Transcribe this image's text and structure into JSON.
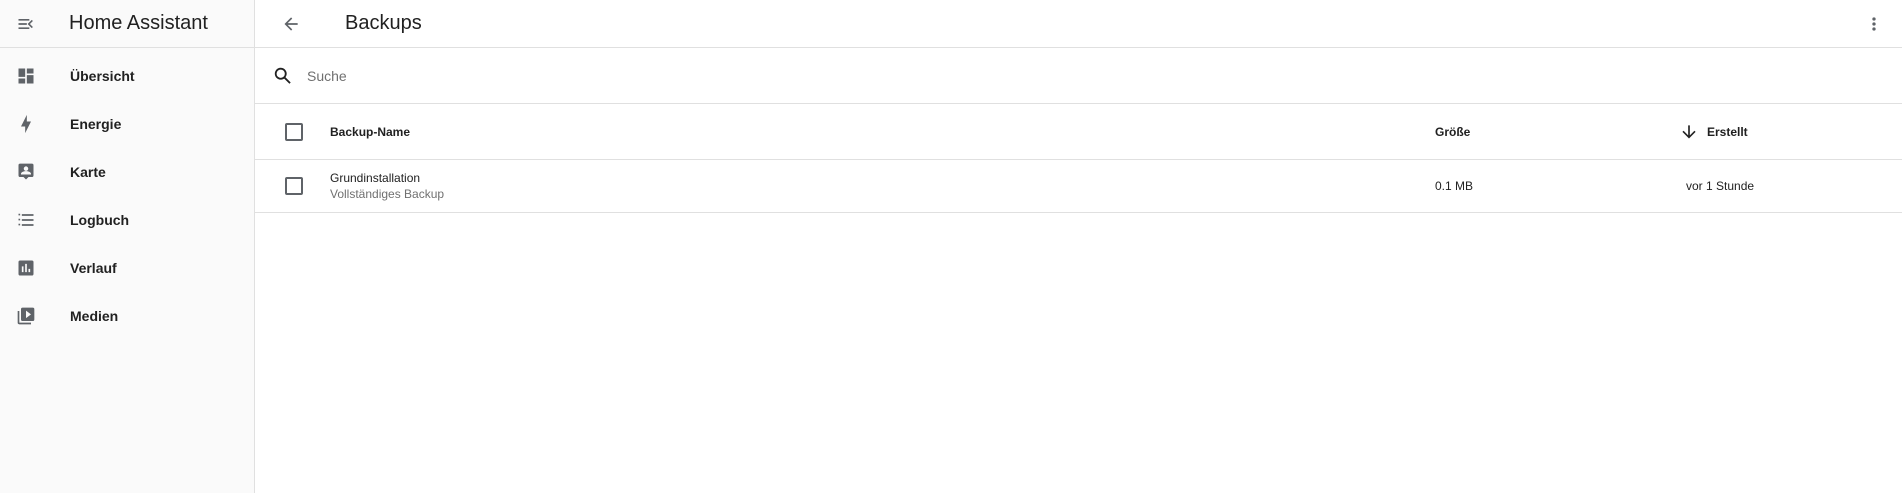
{
  "sidebar": {
    "title": "Home Assistant",
    "items": [
      {
        "label": "Übersicht",
        "icon": "dashboard-icon"
      },
      {
        "label": "Energie",
        "icon": "lightning-icon"
      },
      {
        "label": "Karte",
        "icon": "map-account-icon"
      },
      {
        "label": "Logbuch",
        "icon": "format-list-icon"
      },
      {
        "label": "Verlauf",
        "icon": "chart-box-icon"
      },
      {
        "label": "Medien",
        "icon": "play-box-multiple-icon"
      }
    ]
  },
  "header": {
    "title": "Backups"
  },
  "search": {
    "placeholder": "Suche",
    "value": ""
  },
  "table": {
    "columns": {
      "name": "Backup-Name",
      "size": "Größe",
      "created": "Erstellt"
    },
    "rows": [
      {
        "name": "Grundinstallation",
        "type": "Vollständiges Backup",
        "size": "0.1 MB",
        "created": "vor 1 Stunde"
      }
    ]
  },
  "colors": {
    "icon": "#5f6368",
    "text": "#212121",
    "secondary_text": "#707070",
    "divider": "#e0e0e0"
  }
}
